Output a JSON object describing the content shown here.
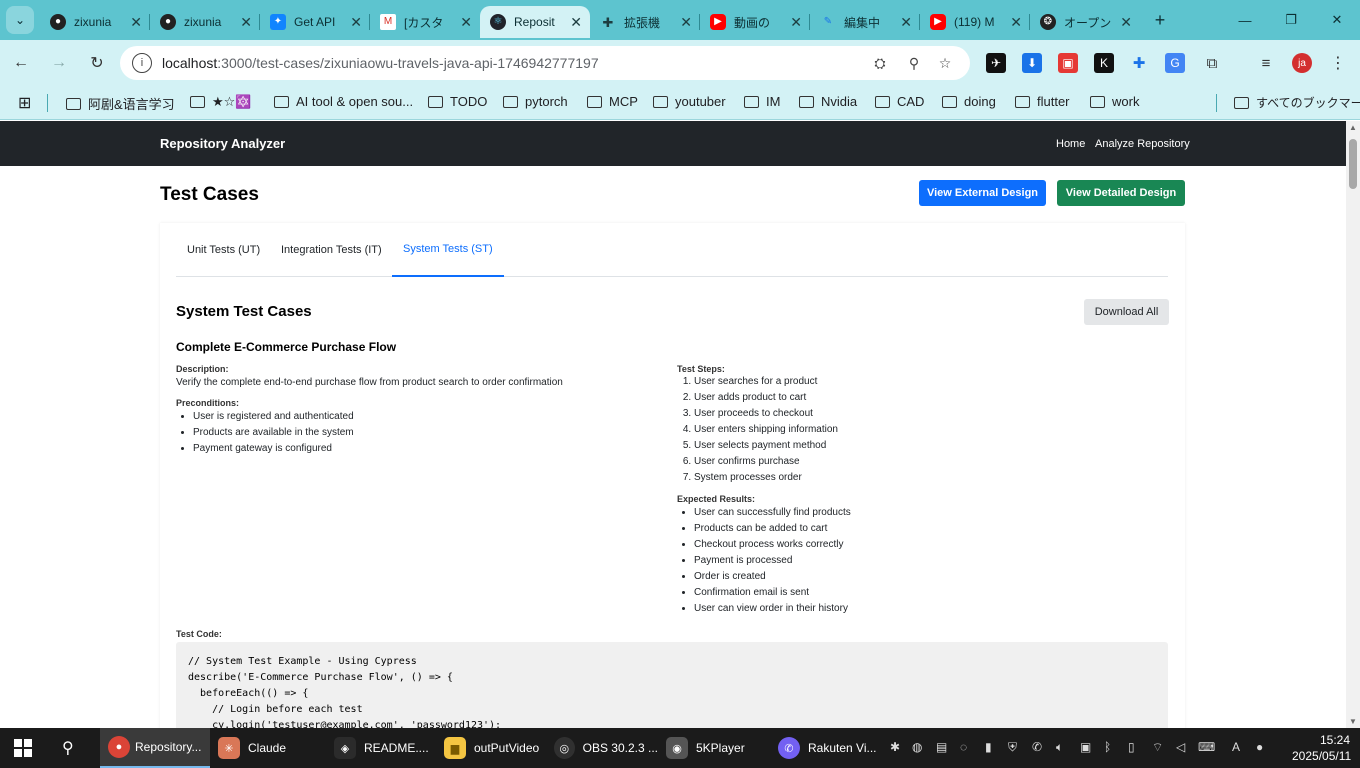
{
  "browser": {
    "tabs": [
      {
        "title": "zixunia",
        "icon": "github-icon"
      },
      {
        "title": "zixunia",
        "icon": "github-icon"
      },
      {
        "title": "Get API",
        "icon": "bluesky-icon"
      },
      {
        "title": "[カスタ",
        "icon": "gmail-icon"
      },
      {
        "title": "Reposit",
        "icon": "react-icon",
        "active": true
      },
      {
        "title": "拡張機",
        "icon": "puzzle-icon"
      },
      {
        "title": "動画の",
        "icon": "youtube-icon"
      },
      {
        "title": "編集中",
        "icon": "edit-icon"
      },
      {
        "title": "(119) M",
        "icon": "youtube-icon"
      },
      {
        "title": "オープン",
        "icon": "openai-icon"
      }
    ],
    "url_host": "localhost",
    "url_path": ":3000/test-cases/zixuniaowu-travels-java-api-1746942777197",
    "profile_initials": "ja",
    "bookmarks": [
      "阿剧&语言学习",
      "★☆🔯",
      "AI tool & open sou...",
      "TODO",
      "pytorch",
      "MCP",
      "youtuber",
      "IM",
      "Nvidia",
      "CAD",
      "doing",
      "flutter",
      "work"
    ],
    "all_bookmarks": "すべてのブックマーク"
  },
  "app": {
    "brand": "Repository Analyzer",
    "nav": {
      "home": "Home",
      "analyze": "Analyze Repository"
    },
    "page_title": "Test Cases",
    "btn_external": "View External Design",
    "btn_detailed": "View Detailed Design",
    "colors": {
      "primary": "#0d6efd",
      "success": "#198754",
      "navbar": "#212529"
    },
    "tabs": {
      "ut": "Unit Tests (UT)",
      "it": "Integration Tests (IT)",
      "st": "System Tests (ST)"
    },
    "section_title": "System Test Cases",
    "download_all": "Download All",
    "case": {
      "title": "Complete E-Commerce Purchase Flow",
      "description_label": "Description:",
      "description": "Verify the complete end-to-end purchase flow from product search to order confirmation",
      "preconditions_label": "Preconditions:",
      "preconditions": [
        "User is registered and authenticated",
        "Products are available in the system",
        "Payment gateway is configured"
      ],
      "steps_label": "Test Steps:",
      "steps": [
        "User searches for a product",
        "User adds product to cart",
        "User proceeds to checkout",
        "User enters shipping information",
        "User selects payment method",
        "User confirms purchase",
        "System processes order"
      ],
      "expected_label": "Expected Results:",
      "expected": [
        "User can successfully find products",
        "Products can be added to cart",
        "Checkout process works correctly",
        "Payment is processed",
        "Order is created",
        "Confirmation email is sent",
        "User can view order in their history"
      ],
      "code_label": "Test Code:",
      "code": "// System Test Example - Using Cypress\ndescribe('E-Commerce Purchase Flow', () => {\n  beforeEach(() => {\n    // Login before each test\n    cy.login('testuser@example.com', 'password123');"
    }
  },
  "taskbar": {
    "apps": [
      {
        "label": "Repository...",
        "icon": "chrome-icon"
      },
      {
        "label": "Claude",
        "icon": "claude-icon"
      },
      {
        "label": "README....",
        "icon": "cursor-icon"
      },
      {
        "label": "outPutVideo",
        "icon": "folder-icon"
      },
      {
        "label": "OBS 30.2.3 ...",
        "icon": "obs-icon"
      },
      {
        "label": "5KPlayer",
        "icon": "5kplayer-icon"
      },
      {
        "label": "Rakuten Vi...",
        "icon": "viber-icon"
      }
    ],
    "ime": "A",
    "time": "15:24",
    "date": "2025/05/11"
  }
}
